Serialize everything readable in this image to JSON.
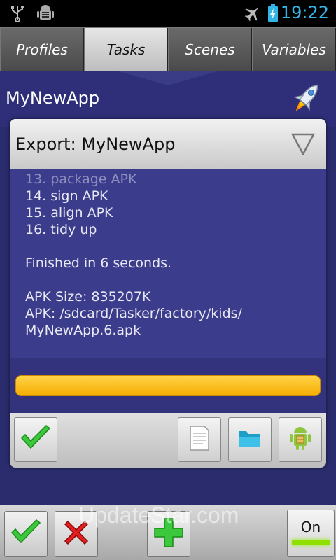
{
  "status_bar": {
    "time": "19:22",
    "icons": [
      "usb-icon",
      "android-debug-icon",
      "airplane-icon",
      "battery-icon"
    ]
  },
  "tabs": [
    {
      "label": "Profiles",
      "active": false
    },
    {
      "label": "Tasks",
      "active": true
    },
    {
      "label": "Scenes",
      "active": false
    },
    {
      "label": "Variables",
      "active": false
    }
  ],
  "header": {
    "title": "MyNewApp",
    "icon": "rocket-icon"
  },
  "dialog": {
    "title": "Export: MyNewApp",
    "dropdown_icon": "triangle-down-icon",
    "log_lines": [
      "13. package APK",
      "14. sign APK",
      "15. align APK",
      "16. tidy up",
      "",
      "Finished in 6 seconds.",
      "",
      "APK Size: 835207K",
      "APK: /sdcard/Tasker/factory/kids/",
      "MyNewApp.6.apk"
    ],
    "progress": 1.0,
    "buttons": [
      "check-icon",
      "document-icon",
      "folder-icon",
      "android-icon"
    ]
  },
  "bottom_bar": {
    "buttons": [
      "check-icon",
      "cross-icon",
      "plus-icon"
    ],
    "toggle_label": "On",
    "watermark": "UpdateStar.com"
  },
  "colors": {
    "accent_blue": "#33b5e5",
    "background": "#2b2c6e",
    "progress": "#f5ad00",
    "toggle_on": "#8fe000"
  }
}
